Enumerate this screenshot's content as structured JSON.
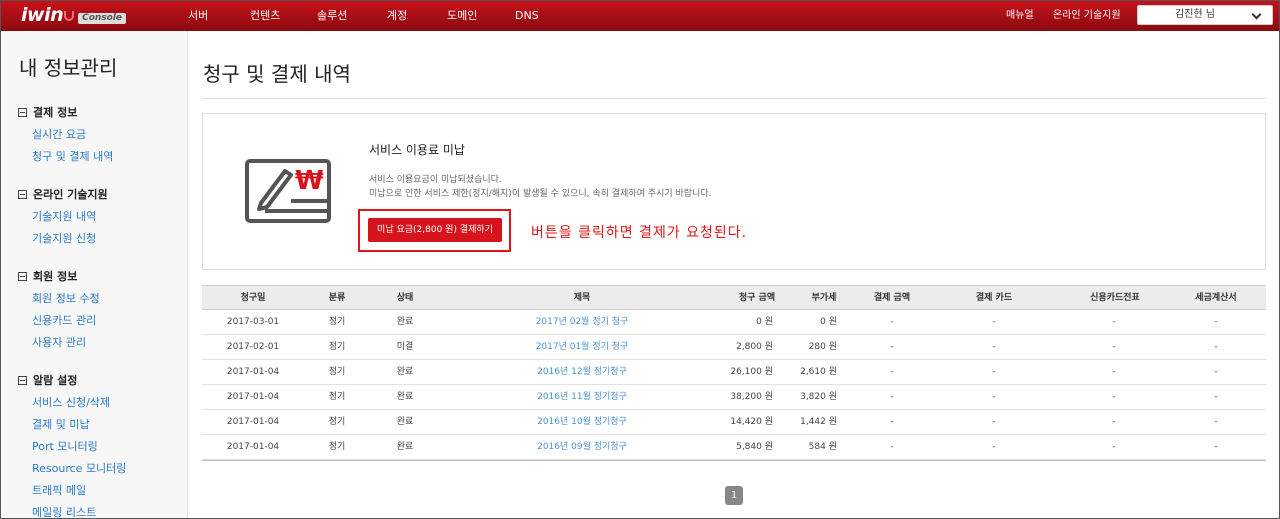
{
  "header": {
    "logo": "iwin",
    "logo_badge": "Console",
    "nav": [
      "서버",
      "컨텐츠",
      "솔루션",
      "계정",
      "도메인",
      "DNS"
    ],
    "manual": "매뉴얼",
    "support": "온라인 기술지원",
    "user": "김진현 님",
    "brand_color": "#c8111a"
  },
  "sidebar": {
    "title": "내 정보관리",
    "groups": [
      {
        "label": "결제 정보",
        "items": [
          "실시간 요금",
          "청구 및 결제 내역"
        ]
      },
      {
        "label": "온라인 기술지원",
        "items": [
          "기술지원 내역",
          "기술지원 신청"
        ]
      },
      {
        "label": "회원 정보",
        "items": [
          "회원 정보 수정",
          "신용카드 관리",
          "사용자 관리"
        ]
      },
      {
        "label": "알람 설정",
        "items": [
          "서비스 신청/삭제",
          "결제 및 미납",
          "Port 모니터링",
          "Resource 모니터링",
          "트래픽 메일",
          "메일링 리스트"
        ]
      }
    ]
  },
  "main": {
    "title": "청구 및 결제 내역",
    "notice": {
      "title": "서비스 이용료 미납",
      "line1": "서비스 이용요금이 미납되셨습니다.",
      "line2": "미납으로 인한 서비스 제한(정지/해지)이 발생될 수 있으니, 속히 결제하여 주시기 바랍니다.",
      "pay_button": "미납 요금(2,800 원) 결제하기",
      "annotation": "버튼을 클릭하면 결제가 요청된다.",
      "icon": "check-won-icon"
    },
    "table": {
      "headers": [
        "청구일",
        "분류",
        "상태",
        "제목",
        "청구 금액",
        "부가세",
        "결제 금액",
        "결제 카드",
        "신용카드전표",
        "세금계산서"
      ],
      "rows": [
        [
          "2017-03-01",
          "정기",
          "완료",
          "2017년 02월 정기 청구",
          "0 원",
          "0 원",
          "-",
          "-",
          "-",
          "-"
        ],
        [
          "2017-02-01",
          "정기",
          "미결",
          "2017년 01월 정기 청구",
          "2,800 원",
          "280 원",
          "-",
          "-",
          "-",
          "-"
        ],
        [
          "2017-01-04",
          "정기",
          "완료",
          "2016년 12월 정기청구",
          "26,100 원",
          "2,610 원",
          "-",
          "-",
          "-",
          "-"
        ],
        [
          "2017-01-04",
          "정기",
          "완료",
          "2016년 11월 정기청구",
          "38,200 원",
          "3,820 원",
          "-",
          "-",
          "-",
          "-"
        ],
        [
          "2017-01-04",
          "정기",
          "완료",
          "2016년 10월 정기청구",
          "14,420 원",
          "1,442 원",
          "-",
          "-",
          "-",
          "-"
        ],
        [
          "2017-01-04",
          "정기",
          "완료",
          "2016년 09월 정기청구",
          "5,840 원",
          "584 원",
          "-",
          "-",
          "-",
          "-"
        ]
      ]
    },
    "pagination": {
      "current": "1"
    }
  }
}
